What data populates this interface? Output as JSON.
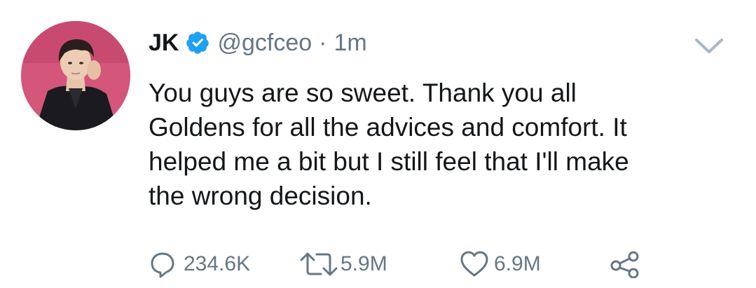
{
  "user": {
    "display_name": "JK",
    "handle": "@gcfceo",
    "separator": "·",
    "time": "1m",
    "verified": true
  },
  "tweet": {
    "text_lines": [
      "You guys are so sweet. Thank you all",
      "Goldens for all the advices and comfort. It",
      "helped me a bit but I still feel that I'll make",
      "the wrong decision."
    ]
  },
  "actions": {
    "reply_count": "234.6K",
    "retweet_count": "5.9M",
    "like_count": "6.9M"
  },
  "colors": {
    "verified_blue": "#1da1f2",
    "muted_gray": "#657786",
    "text": "#14171a",
    "avatar_bg": "#d4567a"
  },
  "icons": {
    "verified": "verified-badge-icon",
    "caret": "chevron-down-icon",
    "reply": "reply-bubble-icon",
    "retweet": "retweet-icon",
    "like": "heart-icon",
    "share": "share-icon"
  }
}
